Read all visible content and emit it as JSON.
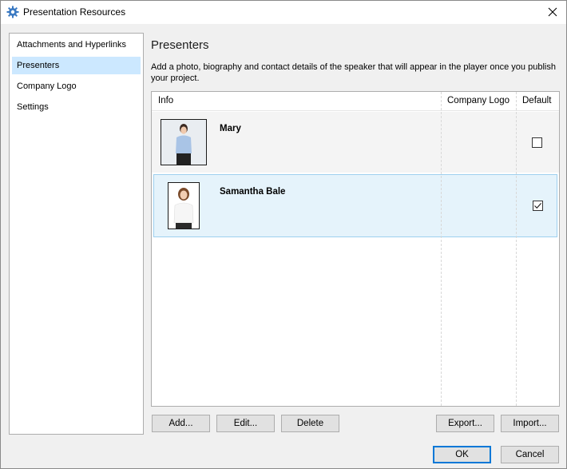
{
  "window": {
    "title": "Presentation Resources",
    "close_glyph": "✕"
  },
  "sidebar": {
    "items": [
      {
        "label": "Attachments and Hyperlinks",
        "selected": false
      },
      {
        "label": "Presenters",
        "selected": true
      },
      {
        "label": "Company Logo",
        "selected": false
      },
      {
        "label": "Settings",
        "selected": false
      }
    ]
  },
  "main": {
    "heading": "Presenters",
    "description": "Add a photo, biography and contact details of the speaker that will appear in the player once you publish your project.",
    "table": {
      "columns": [
        "Info",
        "Company Logo",
        "Default"
      ],
      "rows": [
        {
          "name": "Mary",
          "default": false
        },
        {
          "name": "Samantha Bale",
          "default": true
        }
      ]
    }
  },
  "buttons": {
    "add": "Add...",
    "edit": "Edit...",
    "delete": "Delete",
    "export": "Export...",
    "import": "Import...",
    "ok": "OK",
    "cancel": "Cancel"
  },
  "colors": {
    "selection": "#cce8ff",
    "row_selected": "#e5f3fb",
    "accent": "#0078d7"
  }
}
